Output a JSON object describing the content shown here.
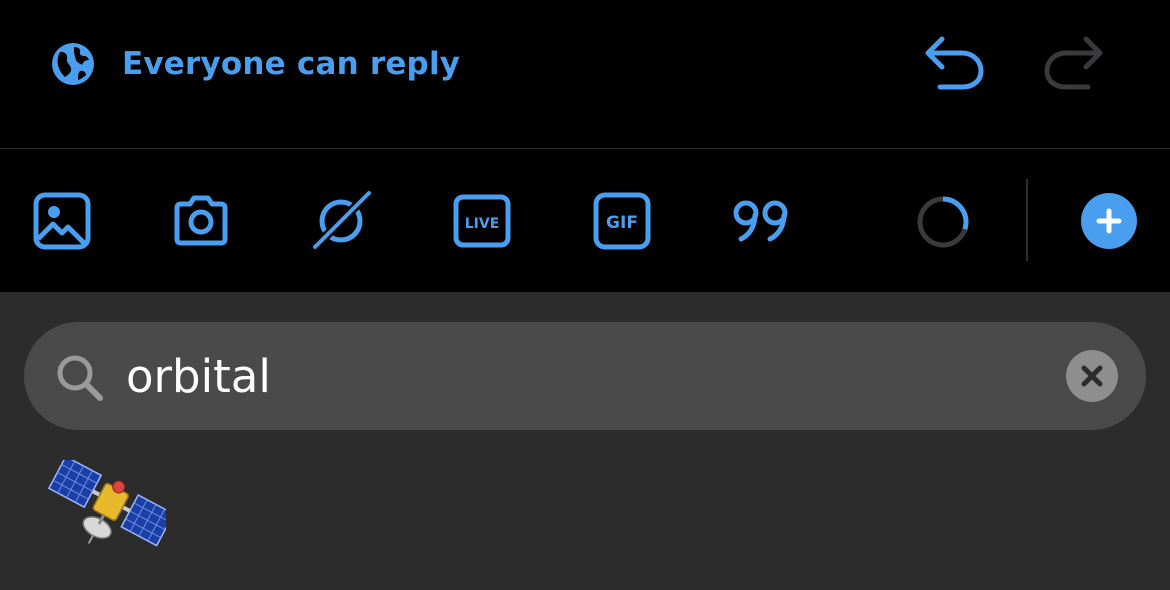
{
  "reply_settings": {
    "label": "Everyone can reply",
    "icon": "globe-icon"
  },
  "history": {
    "undo_icon": "undo-icon",
    "redo_icon": "redo-icon",
    "redo_enabled": false
  },
  "toolbar": {
    "items": [
      {
        "name": "image-icon"
      },
      {
        "name": "camera-icon"
      },
      {
        "name": "space-icon"
      },
      {
        "name": "live-icon",
        "label": "LIVE"
      },
      {
        "name": "gif-icon",
        "label": "GIF"
      },
      {
        "name": "quote-icon"
      }
    ],
    "character_count_progress": 0.3,
    "add_icon": "plus-icon"
  },
  "emoji_search": {
    "query": "orbital",
    "results": [
      {
        "name": "satellite"
      }
    ]
  },
  "colors": {
    "accent": "#4a9ef0",
    "background": "#000000",
    "panel": "#2c2c2c",
    "search_field": "#4a4a4a",
    "disabled": "#3a3a3c"
  }
}
